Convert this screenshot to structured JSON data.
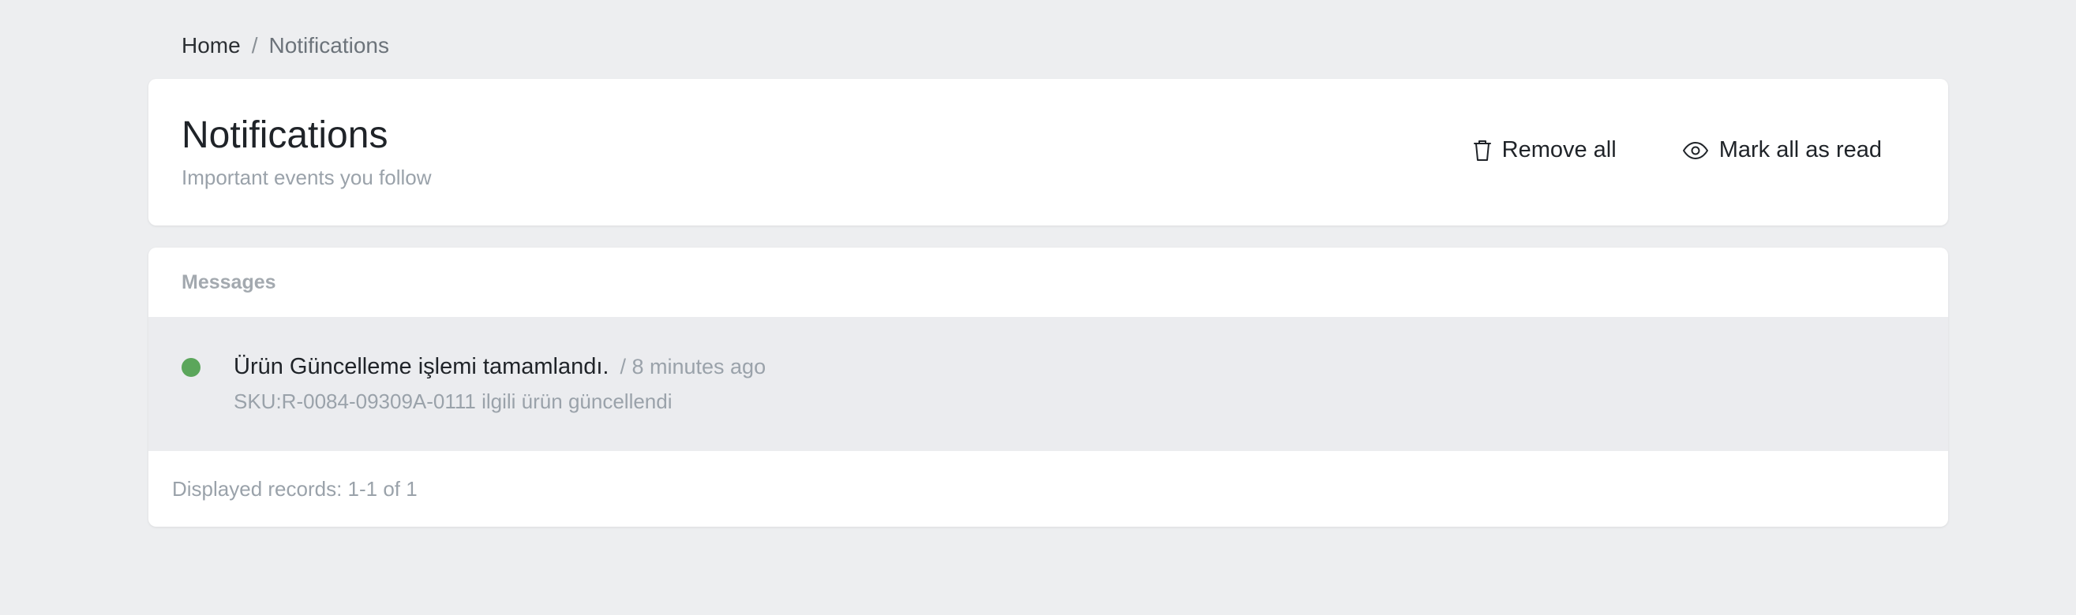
{
  "breadcrumb": {
    "home": "Home",
    "separator": "/",
    "current": "Notifications"
  },
  "header": {
    "title": "Notifications",
    "subtitle": "Important events you follow",
    "actions": {
      "remove_all": {
        "label": "Remove all",
        "icon": "trash-icon"
      },
      "mark_all_read": {
        "label": "Mark all as read",
        "icon": "eye-icon"
      }
    }
  },
  "messages": {
    "heading": "Messages",
    "items": [
      {
        "title": "Ürün Güncelleme işlemi tamamlandı.",
        "time": "/ 8 minutes ago",
        "body": "SKU:R-0084-09309A-0111 ilgili ürün güncellendi",
        "status_color": "#5ba65b"
      }
    ],
    "footer": "Displayed records: 1-1 of 1"
  }
}
